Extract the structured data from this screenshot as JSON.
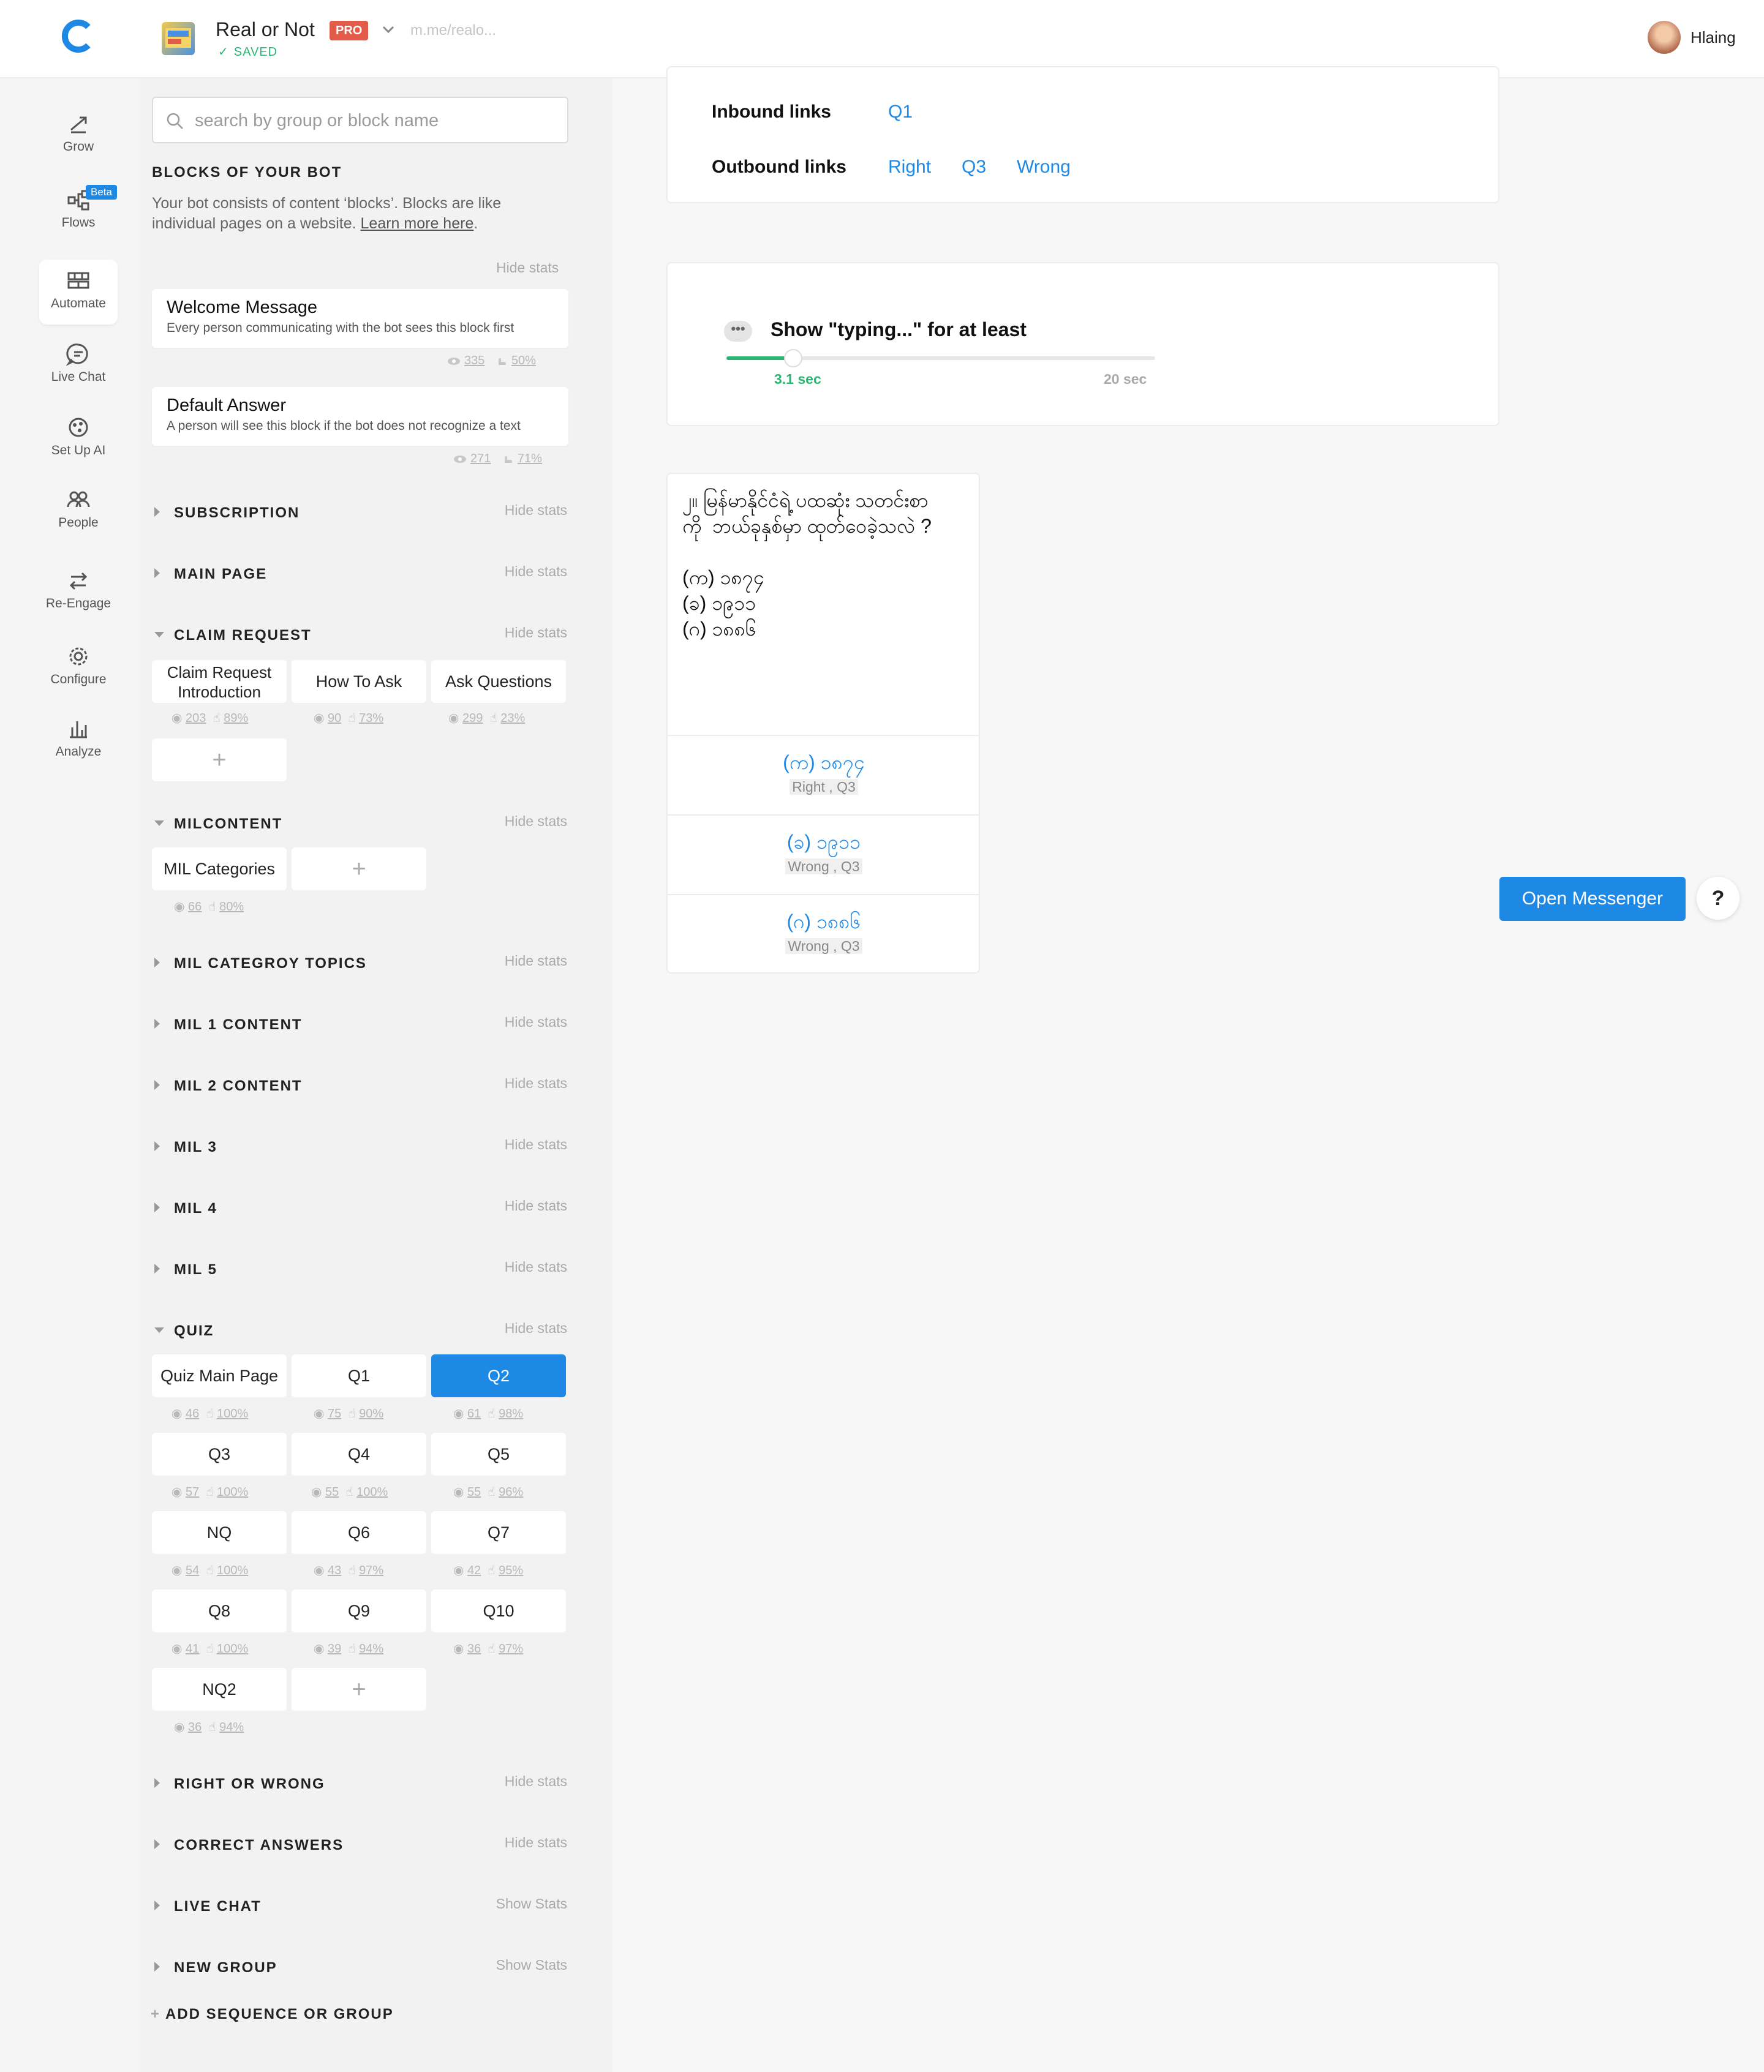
{
  "header": {
    "bot_name": "Real or Not",
    "plan_badge": "PRO",
    "bot_link": "m.me/realo...",
    "save_status": "SAVED",
    "user_name": "Hlaing"
  },
  "nav": {
    "items": [
      {
        "label": "Grow",
        "icon": "grow-icon"
      },
      {
        "label": "Flows",
        "icon": "flows-icon",
        "badge": "Beta"
      },
      {
        "label": "Automate",
        "icon": "automate-icon",
        "active": true
      },
      {
        "label": "Live Chat",
        "icon": "live-chat-icon"
      },
      {
        "label": "Set Up AI",
        "icon": "ai-icon"
      },
      {
        "label": "People",
        "icon": "people-icon"
      },
      {
        "label": "Re-Engage",
        "icon": "re-engage-icon"
      },
      {
        "label": "Configure",
        "icon": "gear-icon"
      },
      {
        "label": "Analyze",
        "icon": "analyze-icon"
      }
    ]
  },
  "blocks_panel": {
    "search_placeholder": "search by group or block name",
    "title": "BLOCKS OF YOUR BOT",
    "description": "Your bot consists of content ‘blocks’. Blocks are like individual pages on a website.",
    "learn_more": "Learn more here",
    "hide_stats": "Hide stats",
    "show_stats": "Show Stats",
    "welcome": {
      "title": "Welcome Message",
      "subtitle": "Every person communicating with the bot sees this block first",
      "views": "335",
      "ctr": "50%"
    },
    "default": {
      "title": "Default Answer",
      "subtitle": "A person will see this block if the bot does not recognize a text",
      "views": "271",
      "ctr": "71%"
    },
    "groups": {
      "subscription": "SUBSCRIPTION",
      "main_page": "MAIN PAGE",
      "claim_request": "CLAIM REQUEST",
      "milcontent": "MILCONTENT",
      "mil_category_topics": "MIL CATEGROY TOPICS",
      "mil1": "MIL 1 CONTENT",
      "mil2": "MIL 2 CONTENT",
      "mil3": "MIL 3",
      "mil4": "MIL 4",
      "mil5": "MIL 5",
      "quiz": "QUIZ",
      "right_or_wrong": "RIGHT OR WRONG",
      "correct_answers": "CORRECT ANSWERS",
      "live_chat": "LIVE CHAT",
      "new_group": "NEW GROUP"
    },
    "claim_tiles": [
      {
        "label": "Claim Request Introduction",
        "views": "203",
        "ctr": "89%"
      },
      {
        "label": "How To Ask",
        "views": "90",
        "ctr": "73%"
      },
      {
        "label": "Ask Questions",
        "views": "299",
        "ctr": "23%"
      }
    ],
    "mil_tiles": [
      {
        "label": "MIL Categories",
        "views": "66",
        "ctr": "80%"
      }
    ],
    "quiz_tiles": [
      {
        "label": "Quiz Main Page",
        "views": "46",
        "ctr": "100%"
      },
      {
        "label": "Q1",
        "views": "75",
        "ctr": "90%"
      },
      {
        "label": "Q2",
        "views": "61",
        "ctr": "98%"
      },
      {
        "label": "Q3",
        "views": "57",
        "ctr": "100%"
      },
      {
        "label": "Q4",
        "views": "55",
        "ctr": "100%"
      },
      {
        "label": "Q5",
        "views": "55",
        "ctr": "96%"
      },
      {
        "label": "NQ",
        "views": "54",
        "ctr": "100%"
      },
      {
        "label": "Q6",
        "views": "43",
        "ctr": "97%"
      },
      {
        "label": "Q7",
        "views": "42",
        "ctr": "95%"
      },
      {
        "label": "Q8",
        "views": "41",
        "ctr": "100%"
      },
      {
        "label": "Q9",
        "views": "39",
        "ctr": "94%"
      },
      {
        "label": "Q10",
        "views": "36",
        "ctr": "97%"
      },
      {
        "label": "NQ2",
        "views": "36",
        "ctr": "94%"
      }
    ],
    "add_sequence": "ADD SEQUENCE OR GROUP"
  },
  "editor": {
    "inbound_label": "Inbound links",
    "inbound": [
      "Q1"
    ],
    "outbound_label": "Outbound links",
    "outbound": [
      "Right",
      "Q3",
      "Wrong"
    ],
    "typing_label": "Show \"typing...\" for at least",
    "typing_value": "3.1 sec",
    "typing_max": "20 sec",
    "typing_fraction": 0.155,
    "question_text": "၂။ မြန်မာနိုင်ငံရဲ့ ပထဆုံး သတင်းစာ\nကို  ဘယ်ခုနှစ်မှာ ထုတ်ဝေခဲ့သလဲ ?\n\n(က) ၁၈၇၄\n(ခ) ၁၉၁၁\n(ဂ) ၁၈၈၆",
    "buttons": [
      {
        "label": "(က) ၁၈၇၄",
        "targets": "Right , Q3"
      },
      {
        "label": "(ခ) ၁၉၁၁",
        "targets": "Wrong , Q3"
      },
      {
        "label": "(ဂ) ၁၈၈၆",
        "targets": "Wrong , Q3"
      }
    ]
  },
  "actions": {
    "open_messenger": "Open Messenger",
    "help": "?"
  },
  "colors": {
    "accent": "#1e88e5",
    "success": "#2bb673",
    "pro": "#e25a48"
  }
}
